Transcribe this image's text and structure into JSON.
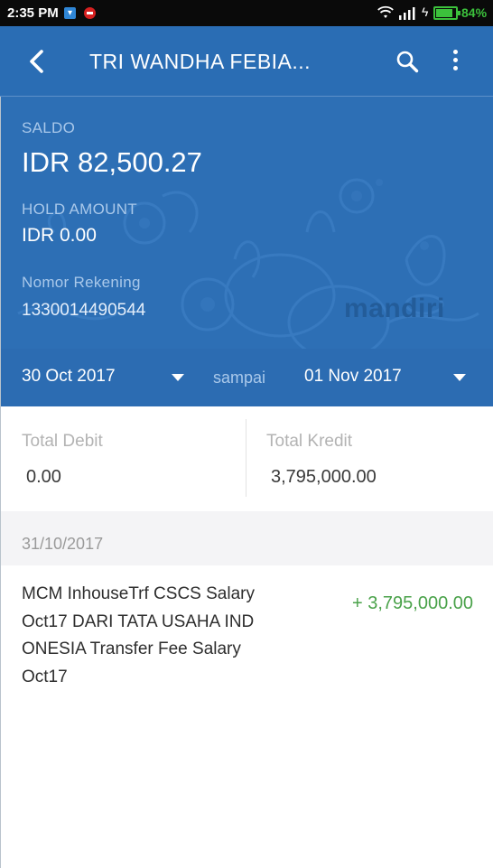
{
  "status_bar": {
    "time": "2:35 PM",
    "battery_percent": "84%",
    "battery_level": 0.84,
    "icons": [
      "notification-icon",
      "record-icon",
      "wifi-icon",
      "signal-icon",
      "charging-icon",
      "battery-icon"
    ]
  },
  "app_bar": {
    "title": "TRI WANDHA FEBIA...",
    "icons": [
      "back-icon",
      "search-icon",
      "more-vert-icon"
    ]
  },
  "account": {
    "saldo_label": "SALDO",
    "saldo_value": "IDR 82,500.27",
    "hold_label": "HOLD AMOUNT",
    "hold_value": "IDR 0.00",
    "nomor_label": "Nomor Rekening",
    "nomor_value": "1330014490544",
    "brand": "mandiri"
  },
  "date_range": {
    "from": "30 Oct 2017",
    "separator": "sampai",
    "to": "01 Nov 2017"
  },
  "totals": {
    "debit_label": "Total Debit",
    "debit_value": "0.00",
    "kredit_label": "Total Kredit",
    "kredit_value": "3,795,000.00"
  },
  "transactions": [
    {
      "date": "31/10/2017",
      "description": "MCM InhouseTrf CSCS Salary Oct17 DARI TATA USAHA INDONESIA Transfer Fee Salary Oct17",
      "amount": "+ 3,795,000.00",
      "amount_color": "#4aa24a"
    }
  ],
  "colors": {
    "primary": "#2a6db4",
    "credit": "#4aa24a"
  }
}
